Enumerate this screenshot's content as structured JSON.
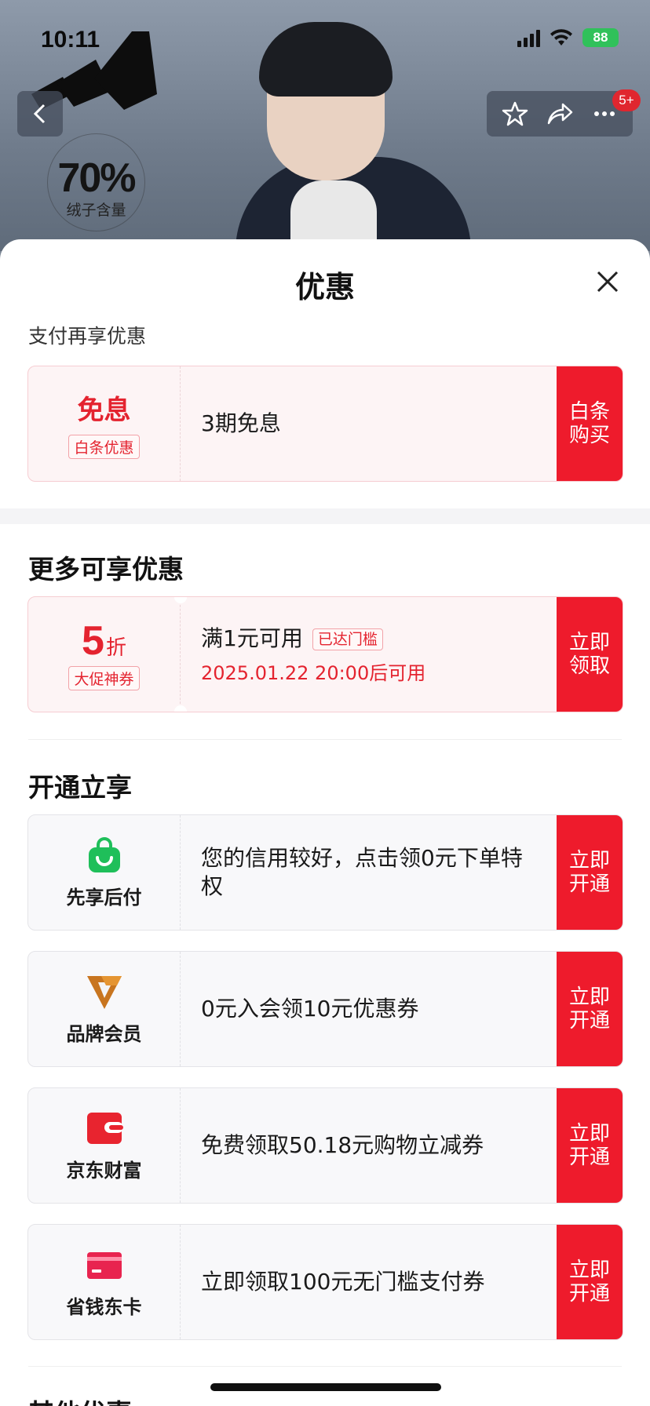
{
  "status_bar": {
    "time": "10:11",
    "battery": "88"
  },
  "header": {
    "notification_badge": "5+"
  },
  "product_badge": {
    "value": "70%",
    "caption": "绒子含量"
  },
  "sheet": {
    "title": "优惠",
    "pay_section": {
      "label": "支付再享优惠",
      "card": {
        "title": "免息",
        "tag": "白条优惠",
        "text": "3期免息",
        "action": "白条购买"
      }
    },
    "more_section": {
      "heading": "更多可享优惠",
      "card": {
        "discount_number": "5",
        "discount_unit": "折",
        "tag": "大促神券",
        "text": "满1元可用",
        "text_tag": "已达门槛",
        "subtext": "2025.01.22 20:00后可用",
        "action": "立即领取"
      }
    },
    "open_section": {
      "heading": "开通立享",
      "items": [
        {
          "icon": "green-shopping-bag-icon",
          "label": "先享后付",
          "text": "您的信用较好，点击领0元下单特权",
          "action": "立即开通"
        },
        {
          "icon": "brand-v-logo-icon",
          "label": "品牌会员",
          "text": "0元入会领10元优惠券",
          "action": "立即开通"
        },
        {
          "icon": "red-wallet-icon",
          "label": "京东财富",
          "text": "免费领取50.18元购物立减券",
          "action": "立即开通"
        },
        {
          "icon": "red-card-icon",
          "label": "省钱东卡",
          "text": "立即领取100元无门槛支付券",
          "action": "立即开通"
        }
      ]
    },
    "next_section_heading": "其他优惠"
  },
  "colors": {
    "accent_red": "#ee1b2c",
    "pay_green": "#30c15a"
  }
}
